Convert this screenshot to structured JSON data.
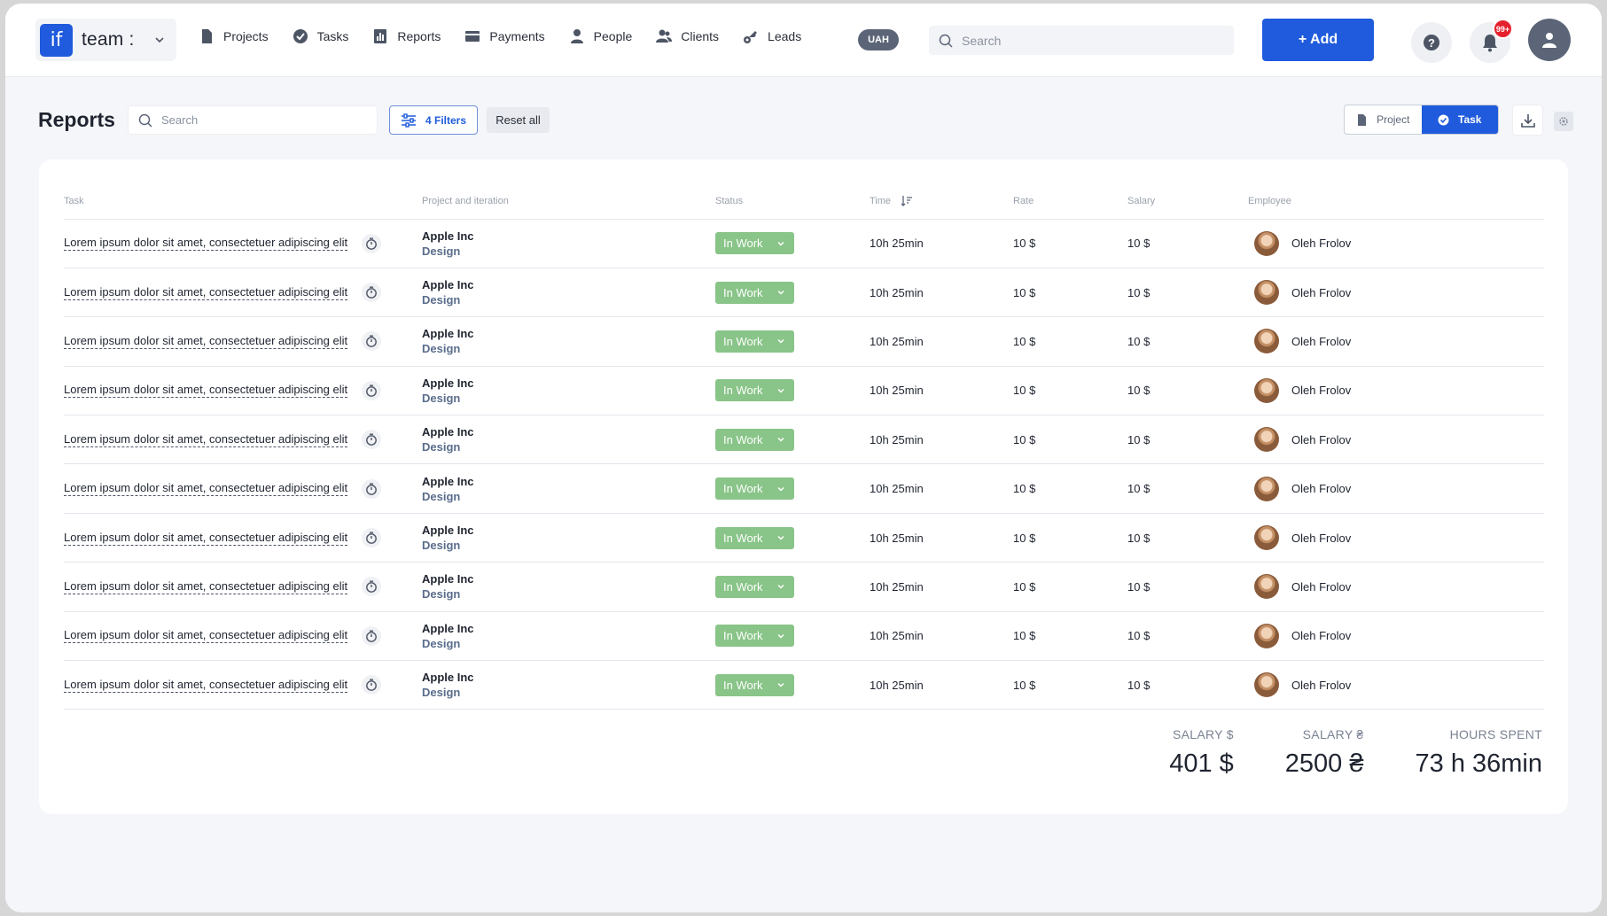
{
  "topbar": {
    "logo_text": "if",
    "team_name": "team :",
    "nav": [
      {
        "label": "Projects",
        "icon": "file-icon"
      },
      {
        "label": "Tasks",
        "icon": "check-circle-icon"
      },
      {
        "label": "Reports",
        "icon": "chart-icon"
      },
      {
        "label": "Payments",
        "icon": "card-icon"
      },
      {
        "label": "People",
        "icon": "person-icon"
      },
      {
        "label": "Clients",
        "icon": "people-icon"
      },
      {
        "label": "Leads",
        "icon": "key-icon"
      }
    ],
    "currency": "UAH",
    "search_placeholder": "Search",
    "add_label": "+ Add",
    "notification_badge": "99+"
  },
  "page": {
    "title": "Reports",
    "search_placeholder": "Search",
    "filters_label": "4 Filters",
    "reset_label": "Reset all",
    "view_options": {
      "project": "Project",
      "task": "Task"
    },
    "active_view": "task"
  },
  "table": {
    "headers": {
      "task": "Task",
      "project": "Project and iteration",
      "status": "Status",
      "time": "Time",
      "rate": "Rate",
      "salary": "Salary",
      "employee": "Employee"
    },
    "rows": [
      {
        "task": "Lorem ipsum dolor sit amet, consectetuer adipiscing elit",
        "project": "Apple Inc",
        "iteration": "Design",
        "status": "In Work",
        "time": "10h 25min",
        "rate": "10 $",
        "salary": "10 $",
        "employee": "Oleh Frolov"
      },
      {
        "task": "Lorem ipsum dolor sit amet, consectetuer adipiscing elit",
        "project": "Apple Inc",
        "iteration": "Design",
        "status": "In Work",
        "time": "10h 25min",
        "rate": "10 $",
        "salary": "10 $",
        "employee": "Oleh Frolov"
      },
      {
        "task": "Lorem ipsum dolor sit amet, consectetuer adipiscing elit",
        "project": "Apple Inc",
        "iteration": "Design",
        "status": "In Work",
        "time": "10h 25min",
        "rate": "10 $",
        "salary": "10 $",
        "employee": "Oleh Frolov"
      },
      {
        "task": "Lorem ipsum dolor sit amet, consectetuer adipiscing elit",
        "project": "Apple Inc",
        "iteration": "Design",
        "status": "In Work",
        "time": "10h 25min",
        "rate": "10 $",
        "salary": "10 $",
        "employee": "Oleh Frolov"
      },
      {
        "task": "Lorem ipsum dolor sit amet, consectetuer adipiscing elit",
        "project": "Apple Inc",
        "iteration": "Design",
        "status": "In Work",
        "time": "10h 25min",
        "rate": "10 $",
        "salary": "10 $",
        "employee": "Oleh Frolov"
      },
      {
        "task": "Lorem ipsum dolor sit amet, consectetuer adipiscing elit",
        "project": "Apple Inc",
        "iteration": "Design",
        "status": "In Work",
        "time": "10h 25min",
        "rate": "10 $",
        "salary": "10 $",
        "employee": "Oleh Frolov"
      },
      {
        "task": "Lorem ipsum dolor sit amet, consectetuer adipiscing elit",
        "project": "Apple Inc",
        "iteration": "Design",
        "status": "In Work",
        "time": "10h 25min",
        "rate": "10 $",
        "salary": "10 $",
        "employee": "Oleh Frolov"
      },
      {
        "task": "Lorem ipsum dolor sit amet, consectetuer adipiscing elit",
        "project": "Apple Inc",
        "iteration": "Design",
        "status": "In Work",
        "time": "10h 25min",
        "rate": "10 $",
        "salary": "10 $",
        "employee": "Oleh Frolov"
      },
      {
        "task": "Lorem ipsum dolor sit amet, consectetuer adipiscing elit",
        "project": "Apple Inc",
        "iteration": "Design",
        "status": "In Work",
        "time": "10h 25min",
        "rate": "10 $",
        "salary": "10 $",
        "employee": "Oleh Frolov"
      },
      {
        "task": "Lorem ipsum dolor sit amet, consectetuer adipiscing elit",
        "project": "Apple Inc",
        "iteration": "Design",
        "status": "In Work",
        "time": "10h 25min",
        "rate": "10 $",
        "salary": "10 $",
        "employee": "Oleh Frolov"
      }
    ]
  },
  "totals": {
    "salary_usd_label": "SALARY $",
    "salary_usd_value": "401 $",
    "salary_uah_label": "SALARY ₴",
    "salary_uah_value": "2500 ₴",
    "hours_label": "HOURS SPENT",
    "hours_value": "73 h 36min"
  },
  "colors": {
    "accent": "#1f5bdc",
    "status_in_work": "#89c488",
    "badge": "#e5202e",
    "background": "#f4f6f9"
  }
}
